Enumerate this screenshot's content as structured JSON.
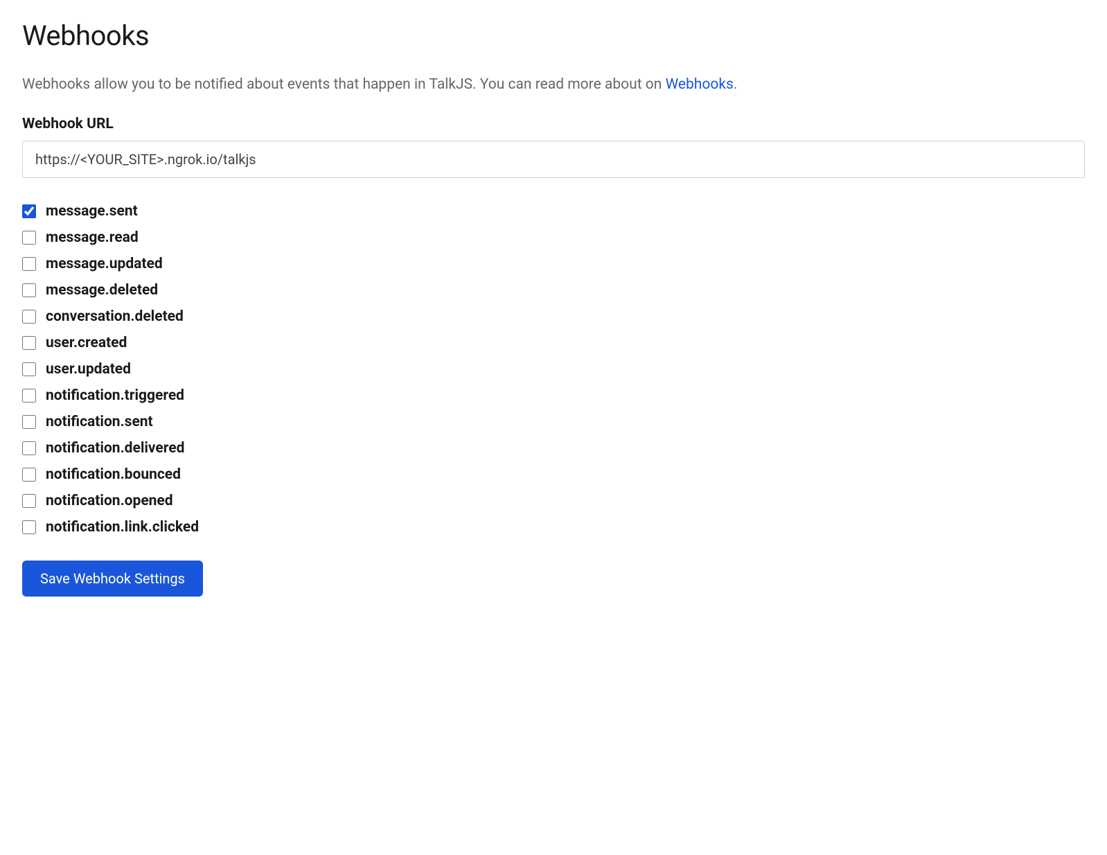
{
  "page": {
    "title": "Webhooks",
    "description_prefix": "Webhooks allow you to be notified about events that happen in TalkJS. You can read more about on ",
    "description_link": "Webhooks",
    "description_suffix": "."
  },
  "form": {
    "url_label": "Webhook URL",
    "url_value": "https://<YOUR_SITE>.ngrok.io/talkjs",
    "save_button": "Save Webhook Settings"
  },
  "events": [
    {
      "name": "message.sent",
      "checked": true
    },
    {
      "name": "message.read",
      "checked": false
    },
    {
      "name": "message.updated",
      "checked": false
    },
    {
      "name": "message.deleted",
      "checked": false
    },
    {
      "name": "conversation.deleted",
      "checked": false
    },
    {
      "name": "user.created",
      "checked": false
    },
    {
      "name": "user.updated",
      "checked": false
    },
    {
      "name": "notification.triggered",
      "checked": false
    },
    {
      "name": "notification.sent",
      "checked": false
    },
    {
      "name": "notification.delivered",
      "checked": false
    },
    {
      "name": "notification.bounced",
      "checked": false
    },
    {
      "name": "notification.opened",
      "checked": false
    },
    {
      "name": "notification.link.clicked",
      "checked": false
    }
  ]
}
